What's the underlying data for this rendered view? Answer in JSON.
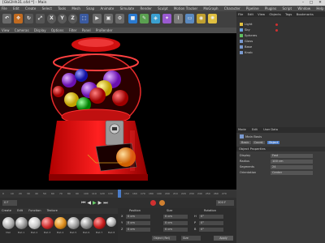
{
  "window": {
    "title": "[Gbl2Hh31.c4d *] - Main",
    "minimize": "–",
    "maximize": "□",
    "close": "✕"
  },
  "menu": [
    "File",
    "Edit",
    "Create",
    "Select",
    "Tools",
    "Mesh",
    "Snap",
    "Animate",
    "Simulate",
    "Render",
    "Sculpt",
    "Motion Tracker",
    "MoGraph",
    "Character",
    "Pipeline",
    "Plugins",
    "Script",
    "Window",
    "Help"
  ],
  "toolbar": {
    "x_label": "X",
    "y_label": "Y",
    "z_label": "Z"
  },
  "view_tabs": [
    "View",
    "Cameras",
    "Display",
    "Options",
    "Filter",
    "Panel",
    "ProRender"
  ],
  "right_tabs": [
    "File",
    "Edit",
    "View",
    "Objects",
    "Tags",
    "Bookmarks"
  ],
  "objects": [
    "Light",
    "Sky",
    "Spheres",
    "Glass",
    "Base",
    "Knob"
  ],
  "attributes": {
    "tabs": [
      "Mode",
      "Edit",
      "User Data"
    ],
    "title": "Main Basis",
    "subtabs": [
      "Basic",
      "Coord.",
      "Object"
    ],
    "section": "Object Properties",
    "props": [
      {
        "label": "Display",
        "value": "Fast"
      },
      {
        "label": "Radius",
        "value": "100 cm"
      },
      {
        "label": "Segments",
        "value": "24"
      },
      {
        "label": "Orientation",
        "value": "Center"
      }
    ]
  },
  "timeline": {
    "ticks": [
      "0",
      "10",
      "20",
      "30",
      "40",
      "50",
      "60",
      "70",
      "80",
      "90",
      "100",
      "110",
      "120",
      "130",
      "140",
      "150",
      "160",
      "170",
      "180",
      "190",
      "200",
      "210",
      "220",
      "230",
      "240",
      "250",
      "260",
      "270"
    ],
    "current_frame": "0 F",
    "end_frame": "300 F"
  },
  "materials": {
    "tabs": [
      "Create",
      "Edit",
      "Function",
      "Texture"
    ],
    "items": [
      {
        "name": "Mat",
        "color": "#b0b0b0"
      },
      {
        "name": "Mat.1",
        "color": "#9a9a9a"
      },
      {
        "name": "Mat.2",
        "color": "#c8c8c8"
      },
      {
        "name": "Mat.3",
        "color": "#d03030"
      },
      {
        "name": "Mat.4",
        "color": "#e09020"
      },
      {
        "name": "Mat.5",
        "color": "#a0a0a0"
      },
      {
        "name": "Mat.6",
        "color": "#909090"
      },
      {
        "name": "Mat.7",
        "color": "#cc2020"
      },
      {
        "name": "Mat.8",
        "color": "#b8b8b8"
      }
    ]
  },
  "coordinates": {
    "headers": [
      "Position",
      "Size",
      "Rotation"
    ],
    "rows": [
      {
        "axis": "X",
        "pos": "0 cm",
        "size": "0 cm",
        "rot_label": "H",
        "rot": "0°"
      },
      {
        "axis": "Y",
        "pos": "0 cm",
        "size": "0 cm",
        "rot_label": "P",
        "rot": "0°"
      },
      {
        "axis": "Z",
        "pos": "0 cm",
        "size": "0 cm",
        "rot_label": "B",
        "rot": "0°"
      }
    ],
    "mode": "Object (Rel)",
    "size_mode": "Size",
    "apply": "Apply"
  },
  "colors": {
    "accent": "#4a7cc9",
    "machine_red": "#e01818",
    "glass_red": "#c00000"
  }
}
